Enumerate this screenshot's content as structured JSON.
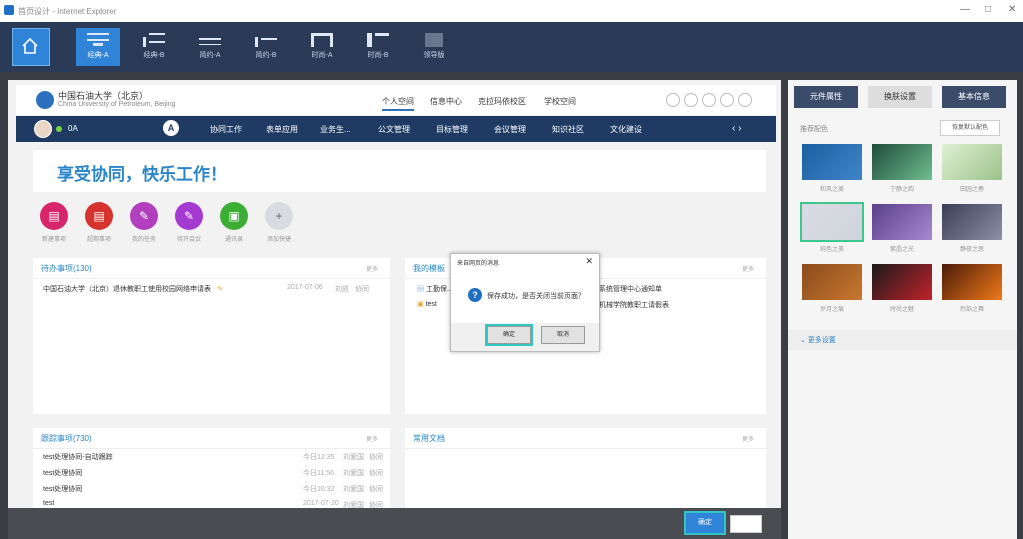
{
  "window": {
    "title": "首页设计 - Internet Explorer",
    "controls": [
      "—",
      "□",
      "✕"
    ]
  },
  "ribbon": {
    "layouts": [
      {
        "label": "经典-A",
        "active": true
      },
      {
        "label": "经典-B"
      },
      {
        "label": "简约-A"
      },
      {
        "label": "简约-B"
      },
      {
        "label": "时尚-A"
      },
      {
        "label": "时尚-B"
      },
      {
        "label": "领导版"
      }
    ]
  },
  "portal": {
    "school_cn": "中国石油大学（北京）",
    "school_en": "China University of Petroleum, Beijing",
    "topnav": [
      "个人空间",
      "信息中心",
      "克拉玛依校区",
      "学校空间"
    ],
    "user": "0A",
    "menu": [
      "协同工作",
      "表单应用",
      "业务生...",
      "公文管理",
      "目标管理",
      "会议管理",
      "知识社区",
      "文化建设"
    ],
    "arrows": "‹  ›",
    "slogan": "享受协同，快乐工作！",
    "quick": [
      {
        "label": "新建事项",
        "color": "#d9256b",
        "glyph": "▤"
      },
      {
        "label": "超期事项",
        "color": "#d4332e",
        "glyph": "▤"
      },
      {
        "label": "我的任务",
        "color": "#b23fbe",
        "glyph": "✎"
      },
      {
        "label": "待开会议",
        "color": "#a53ad0",
        "glyph": "✎"
      },
      {
        "label": "通讯录",
        "color": "#3cae36",
        "glyph": "▣"
      },
      {
        "label": "添加快捷",
        "color": "#d8dce2",
        "glyph": "+"
      }
    ]
  },
  "panels": {
    "pending": {
      "title": "待办事项(130)",
      "more": "更多",
      "rows": [
        {
          "text": "中国石油大学（北京）退休教职工使用校园网络申请表",
          "date": "2017-07-06",
          "user": "刘凯",
          "type": "协同"
        }
      ]
    },
    "mine": {
      "title": "我的模板",
      "more": "更多",
      "item1": "工勤保...",
      "item2": "test",
      "right1": "系统管理中心通知单",
      "right2": "机械学院教职工请假表"
    },
    "tracking": {
      "title": "跟踪事项(730)",
      "more": "更多",
      "rows": [
        {
          "text": "test处理协同-自动跟踪",
          "date": "今日12:35",
          "user": "刘爱国",
          "type": "协同"
        },
        {
          "text": "test处理协同",
          "date": "今日11:56",
          "user": "刘爱国",
          "type": "协同"
        },
        {
          "text": "test处理协同",
          "date": "今日10:32",
          "user": "刘爱国",
          "type": "协同"
        },
        {
          "text": "test",
          "date": "2017-07-20",
          "user": "刘爱国",
          "type": "协同"
        }
      ]
    },
    "docs": {
      "title": "常用文档",
      "more": "更多"
    }
  },
  "dialog": {
    "title": "来自网页的消息",
    "message": "保存成功，是否关闭当前页面？",
    "ok": "确定",
    "cancel": "取消"
  },
  "footer": {
    "ok": "确定"
  },
  "side": {
    "tabs": [
      "元件属性",
      "换肤设置",
      "基本信息"
    ],
    "recommend": "推荐配色",
    "restore": "恢复默认配色",
    "themes": [
      {
        "label": "和风之美",
        "colors": [
          "#1a5fa0",
          "#3f86c8"
        ]
      },
      {
        "label": "宁静之韵",
        "colors": [
          "#1e4b3a",
          "#6fbf8f"
        ]
      },
      {
        "label": "田园之春",
        "colors": [
          "#dff0d2",
          "#9cc28a"
        ]
      },
      {
        "label": "纯色之美",
        "colors": [
          "#d9dde3",
          "#cfd4da"
        ]
      },
      {
        "label": "紫晶之光",
        "colors": [
          "#5a3f8a",
          "#a58ad0"
        ]
      },
      {
        "label": "静夜之思",
        "colors": [
          "#3a3f55",
          "#8c90a8"
        ]
      },
      {
        "label": "岁月之痕",
        "colors": [
          "#8a4b1c",
          "#c8782f"
        ]
      },
      {
        "label": "时尚之魅",
        "colors": [
          "#1a1a1a",
          "#c0222a"
        ]
      },
      {
        "label": "烈焰之舞",
        "colors": [
          "#4a1a08",
          "#f07a1a"
        ]
      }
    ],
    "more_settings": "更多设置"
  }
}
